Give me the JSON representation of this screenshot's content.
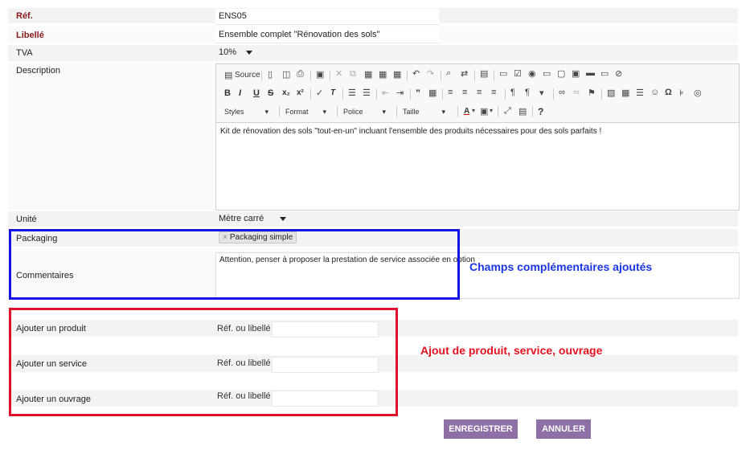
{
  "form": {
    "ref": {
      "label": "Réf.",
      "value": "ENS05"
    },
    "libelle": {
      "label": "Libellé",
      "value": "Ensemble complet \"Rénovation des sols\""
    },
    "tva": {
      "label": "TVA",
      "value": "10%"
    },
    "description": {
      "label": "Description"
    },
    "unite": {
      "label": "Unité",
      "value": "Mètre carré"
    },
    "packaging": {
      "label": "Packaging",
      "tag": "Packaging simple",
      "tag_remove": "×"
    },
    "commentaires": {
      "label": "Commentaires",
      "value": "Attention, penser à proposer la prestation de service associée en option"
    }
  },
  "editor": {
    "source_label": "Source",
    "combos": {
      "styles": "Styles",
      "format": "Format",
      "police": "Police",
      "taille": "Taille"
    },
    "help": "?",
    "content": "Kit de rénovation des sols \"tout-en-un\" incluant l'ensemble des produits nécessaires pour des sols parfaits !"
  },
  "add": {
    "produit": {
      "label": "Ajouter un produit",
      "ref_label": "Réf. ou libellé :"
    },
    "service": {
      "label": "Ajouter un service",
      "ref_label": "Réf. ou libellé :"
    },
    "ouvrage": {
      "label": "Ajouter un ouvrage",
      "ref_label": "Réf. ou libellé :"
    }
  },
  "annotations": {
    "blue": "Champs complémentaires ajoutés",
    "red": "Ajout de produit, service, ouvrage"
  },
  "buttons": {
    "save": "ENREGISTRER",
    "cancel": "ANNULER"
  },
  "colors": {
    "accent_button": "#8e6fa6",
    "label_red": "#8b1a1a",
    "annotation_blue": "#1a35e6",
    "annotation_red": "#e8101e"
  }
}
